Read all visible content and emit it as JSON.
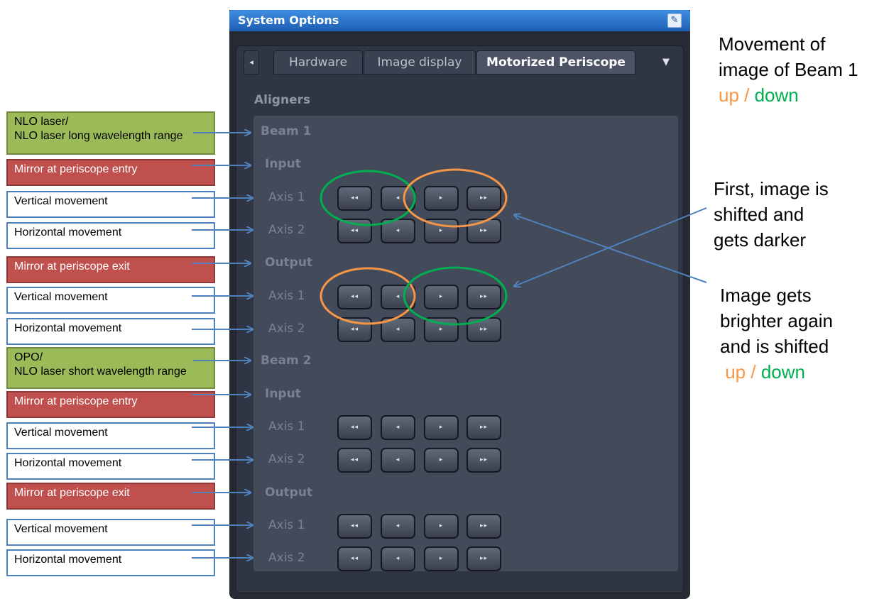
{
  "window": {
    "title": "System Options",
    "pin_icon": "pin-icon"
  },
  "tabs": {
    "items": [
      "Hardware",
      "Image display",
      "Motorized Periscope"
    ],
    "active": "Motorized Periscope"
  },
  "section_title": "Aligners",
  "rows": {
    "beam1": "Beam 1",
    "input": "Input",
    "output": "Output",
    "beam2": "Beam 2",
    "axis1": "Axis 1",
    "axis2": "Axis 2"
  },
  "buttons": {
    "fast_back": "◂◂",
    "back": "◂",
    "forward": "▸",
    "fast_forward": "▸▸"
  },
  "annotations": {
    "nlo_laser_l1": "NLO laser/",
    "nlo_laser_l2": "NLO laser long wavelength range",
    "mirror_entry": "Mirror at periscope entry",
    "mirror_exit": "Mirror at periscope exit",
    "vertical": "Vertical movement",
    "horizontal": "Horizontal movement",
    "opo_l1": "OPO/",
    "opo_l2": "NLO laser short wavelength range"
  },
  "side_notes": {
    "movement_l1": "Movement of",
    "movement_l2": "image of Beam 1",
    "up": "up",
    "slash": " / ",
    "down": "down",
    "first_l1": "First, image is",
    "first_l2": "shifted and",
    "first_l3": "gets darker",
    "bright_l1": "Image gets",
    "bright_l2": "brighter again",
    "bright_l3": "and is shifted",
    "up2": " up",
    "down2": "down"
  },
  "colors": {
    "annotation_green": "#9bbb59",
    "annotation_red": "#c0504d",
    "annotation_border_blue": "#4f81bd",
    "circle_orange": "#f79646",
    "circle_green": "#00b050",
    "arrow_blue": "#4f81bd"
  }
}
